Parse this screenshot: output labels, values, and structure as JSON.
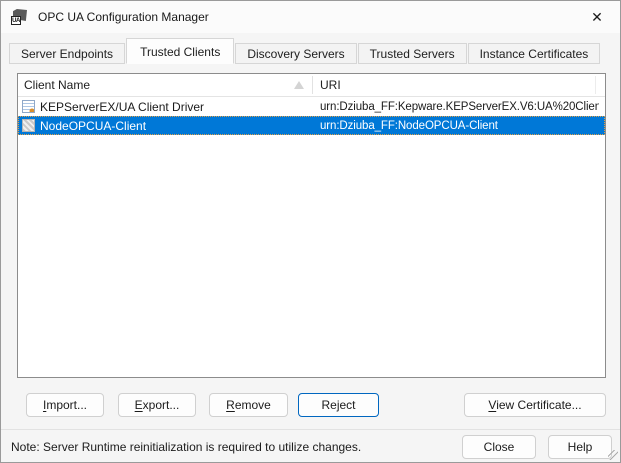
{
  "window": {
    "title": "OPC UA Configuration Manager",
    "close_glyph": "✕",
    "app_icon_text": "UA"
  },
  "tabs": [
    {
      "label": "Server Endpoints",
      "active": false
    },
    {
      "label": "Trusted Clients",
      "active": true
    },
    {
      "label": "Discovery Servers",
      "active": false
    },
    {
      "label": "Trusted Servers",
      "active": false
    },
    {
      "label": "Instance Certificates",
      "active": false
    }
  ],
  "list": {
    "columns": [
      "Client Name",
      "URI"
    ],
    "sort": {
      "column": "Client Name",
      "direction": "ascending"
    },
    "rows": [
      {
        "name": "KEPServerEX/UA Client Driver",
        "uri": "urn:Dziuba_FF:Kepware.KEPServerEX.V6:UA%20Clien...",
        "icon": "certificate-icon",
        "selected": false
      },
      {
        "name": "NodeOPCUA-Client",
        "uri": "urn:Dziuba_FF:NodeOPCUA-Client",
        "icon": "certificate-gray-icon",
        "selected": true
      }
    ]
  },
  "buttons": {
    "import": {
      "mnemonic": "I",
      "rest": "mport..."
    },
    "export": {
      "mnemonic": "E",
      "rest": "xport..."
    },
    "remove": {
      "mnemonic": "R",
      "rest": "emove"
    },
    "reject": {
      "label": "Reject"
    },
    "view_certificate": {
      "mnemonic": "V",
      "rest": "iew Certificate..."
    },
    "close": {
      "label": "Close"
    },
    "help": {
      "label": "Help"
    }
  },
  "footer": {
    "note": "Note: Server Runtime reinitialization is required to utilize changes."
  },
  "colors": {
    "selection_blue": "#0078d7",
    "accent_button_border": "#0067c0",
    "window_background": "#f5f5f5",
    "list_border": "#8c8c8c"
  }
}
